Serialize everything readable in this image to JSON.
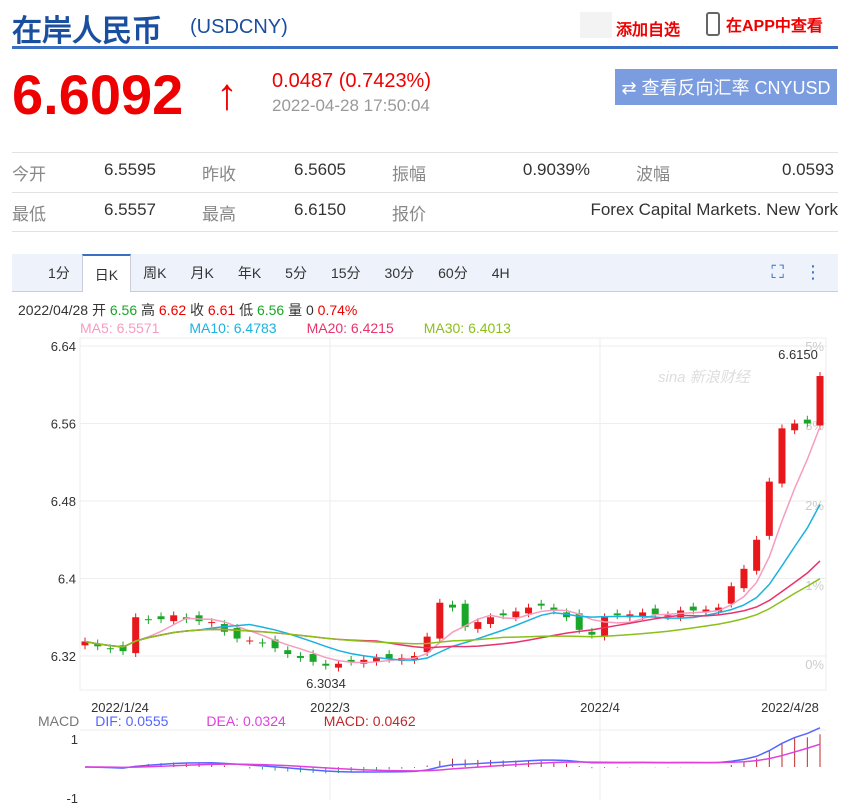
{
  "header": {
    "title": "在岸人民币",
    "code": "(USDCNY)",
    "add_fav": "添加自选",
    "app": "在APP中查看"
  },
  "quote": {
    "price": "6.6092",
    "arrow": "↑",
    "change": "0.0487 (0.7423%)",
    "time": "2022-04-28 17:50:04",
    "reverse_btn": "⇄ 查看反向汇率 CNYUSD"
  },
  "stats": [
    [
      {
        "l": "今开",
        "v": "6.5595"
      },
      {
        "l": "昨收",
        "v": "6.5605"
      },
      {
        "l": "振幅",
        "v": "0.9039%"
      },
      {
        "l": "波幅",
        "v": "0.0593"
      }
    ],
    [
      {
        "l": "最低",
        "v": "6.5557"
      },
      {
        "l": "最高",
        "v": "6.6150"
      },
      {
        "l": "报价",
        "v": "Forex Capital Markets. New York"
      }
    ]
  ],
  "tabs": [
    "1分",
    "日K",
    "周K",
    "月K",
    "年K",
    "5分",
    "15分",
    "30分",
    "60分",
    "4H"
  ],
  "active_tab": 1,
  "info": {
    "date": "2022/04/28",
    "open_l": "开",
    "open": "6.56",
    "high_l": "高",
    "high": "6.62",
    "close_l": "收",
    "close": "6.61",
    "low_l": "低",
    "low": "6.56",
    "vol_l": "量",
    "vol": "0",
    "pct": "0.74%"
  },
  "ma": {
    "ma5": "MA5: 6.5571",
    "ma10": "MA10: 6.4783",
    "ma20": "MA20: 6.4215",
    "ma30": "MA30: 6.4013"
  },
  "colors": {
    "up": "#e8171b",
    "down": "#1aa628",
    "ma5": "#f79cbf",
    "ma10": "#1ab2e0",
    "ma20": "#e8336d",
    "ma30": "#8bbf1a",
    "dif": "#5566ff",
    "dea": "#e040e0"
  },
  "chart_data": {
    "type": "candlestick",
    "y_ticks": [
      "6.64",
      "6.56",
      "6.48",
      "6.4",
      "6.32"
    ],
    "pct_ticks": [
      "5%",
      "3%",
      "2%",
      "1%",
      "0%"
    ],
    "x_ticks": [
      "2022/1/24",
      "2022/3",
      "2022/4",
      "2022/4/28"
    ],
    "max_label": "6.6150",
    "min_label": "6.3034",
    "ylim": [
      6.29,
      6.64
    ],
    "closes": [
      6.335,
      6.33,
      6.327,
      6.325,
      6.36,
      6.357,
      6.358,
      6.362,
      6.358,
      6.356,
      6.355,
      6.345,
      6.338,
      6.336,
      6.333,
      6.328,
      6.322,
      6.318,
      6.314,
      6.31,
      6.312,
      6.314,
      6.316,
      6.318,
      6.317,
      6.318,
      6.32,
      6.34,
      6.375,
      6.37,
      6.35,
      6.355,
      6.36,
      6.362,
      6.366,
      6.37,
      6.372,
      6.367,
      6.36,
      6.347,
      6.342,
      6.36,
      6.362,
      6.363,
      6.365,
      6.363,
      6.362,
      6.367,
      6.367,
      6.368,
      6.37,
      6.392,
      6.41,
      6.44,
      6.5,
      6.555,
      6.56,
      6.56,
      6.609
    ],
    "macd": {
      "label": "MACD",
      "dif": "DIF: 0.0555",
      "dea": "DEA: 0.0324",
      "macd": "MACD: 0.0462",
      "y_ticks": [
        "1",
        "-1"
      ]
    },
    "watermark": "sina 新浪财经"
  }
}
